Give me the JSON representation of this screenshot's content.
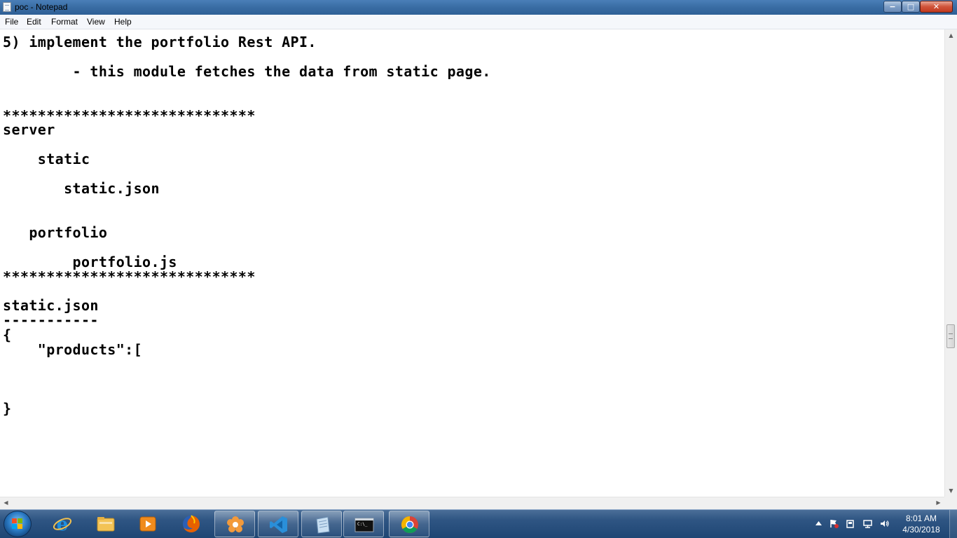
{
  "window": {
    "title": "poc - Notepad"
  },
  "menu": {
    "items": [
      "File",
      "Edit",
      "Format",
      "View",
      "Help"
    ]
  },
  "editor": {
    "text": "5) implement the portfolio Rest API.\n\n        - this module fetches the data from static page.\n\n\n*****************************\nserver\n\n    static\n\n       static.json\n\n\n   portfolio\n\n        portfolio.js\n*****************************\n\nstatic.json\n-----------\n{\n    \"products\":[\n\n\n\n}"
  },
  "caption_buttons": {
    "minimize": "−",
    "maximize": "□",
    "close": "✕"
  },
  "scrollbars": {
    "up_arrow": "▲",
    "down_arrow": "▼",
    "left_arrow": "◀",
    "right_arrow": "▶"
  },
  "taskbar": {
    "apps": [
      {
        "name": "internet-explorer",
        "icon": "internet-explorer-icon",
        "color": "#1e8fe0"
      },
      {
        "name": "file-explorer",
        "icon": "folder-icon",
        "color": "#f3c355"
      },
      {
        "name": "media-player",
        "icon": "media-player-icon",
        "color": "#f08b1d"
      },
      {
        "name": "firefox",
        "icon": "firefox-icon",
        "color": "#e66000"
      },
      {
        "name": "app-flower",
        "icon": "flower-app-icon",
        "color": "#f39a3b"
      },
      {
        "name": "visual-studio-code",
        "icon": "vscode-icon",
        "color": "#2a8fd9"
      },
      {
        "name": "notepad",
        "icon": "notepad-icon",
        "color": "#c8dff2"
      },
      {
        "name": "command-prompt",
        "icon": "command-prompt-icon",
        "color": "#111111"
      },
      {
        "name": "chrome",
        "icon": "chrome-icon",
        "color": "#db4437"
      }
    ],
    "clock": {
      "time": "8:01 AM",
      "date": "4/30/2018"
    }
  }
}
